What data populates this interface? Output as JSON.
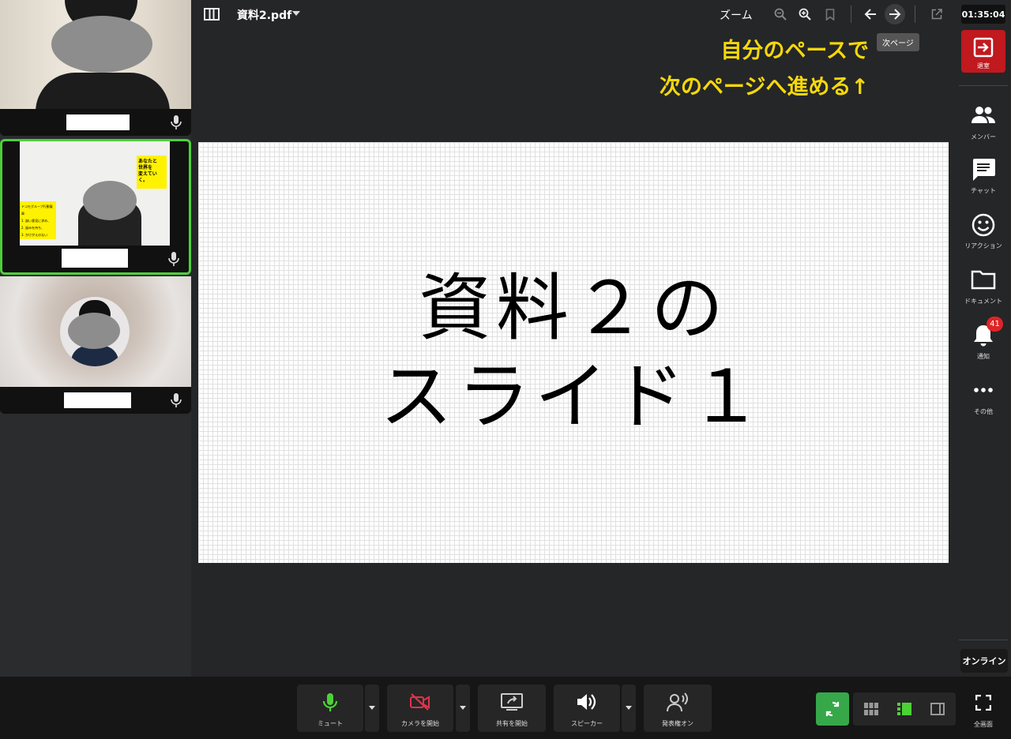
{
  "participants": [
    {
      "name": "",
      "mic": "microphone-icon"
    },
    {
      "name": "",
      "mic": "microphone-icon",
      "active_speaker": true,
      "video_text": [
        "あなたと",
        "世界を",
        "変えていく。",
        "ドコモグループ行動憲章",
        "1. 誠い意見に求め、",
        "2. 誠みを持ち、",
        "3. かけがえのない"
      ]
    },
    {
      "name": "",
      "mic": "microphone-icon"
    }
  ],
  "toolbar": {
    "sidebar_toggle_icon": "columns-icon",
    "document_name": "資料2.pdf",
    "zoom_label": "ズーム",
    "zoom_out_icon": "zoom-out-icon",
    "zoom_in_icon": "zoom-in-icon",
    "bookmark_icon": "bookmark-icon",
    "prev_icon": "arrow-left-icon",
    "next_icon": "arrow-right-icon",
    "popout_icon": "external-link-icon",
    "next_tooltip": "次ページ"
  },
  "annotation": {
    "line1": "自分のペースで",
    "line2": "次のページへ進める↑"
  },
  "slide": {
    "line1": "資料２の",
    "line2": "スライド１"
  },
  "rightbar": {
    "clock": "01:35:04",
    "leave_label": "退室",
    "items": [
      {
        "label": "メンバー",
        "icon": "members-icon"
      },
      {
        "label": "チャット",
        "icon": "chat-icon"
      },
      {
        "label": "リアクション",
        "icon": "smiley-icon"
      },
      {
        "label": "ドキュメント",
        "icon": "folder-icon"
      },
      {
        "label": "通知",
        "icon": "bell-icon"
      },
      {
        "label": "その他",
        "icon": "more-icon"
      }
    ],
    "notification_count": "41",
    "status": "オンライン"
  },
  "controls": {
    "mute": "ミュート",
    "camera": "カメラを開始",
    "share": "共有を開始",
    "speaker": "スピーカー",
    "presenter": "発表権オン",
    "fullscreen": "全画面"
  },
  "colors": {
    "accent_green": "#4cd137",
    "leave_red": "#c0191e",
    "annotation_yellow": "#f5d80b",
    "camera_off_red": "#e0344a"
  }
}
